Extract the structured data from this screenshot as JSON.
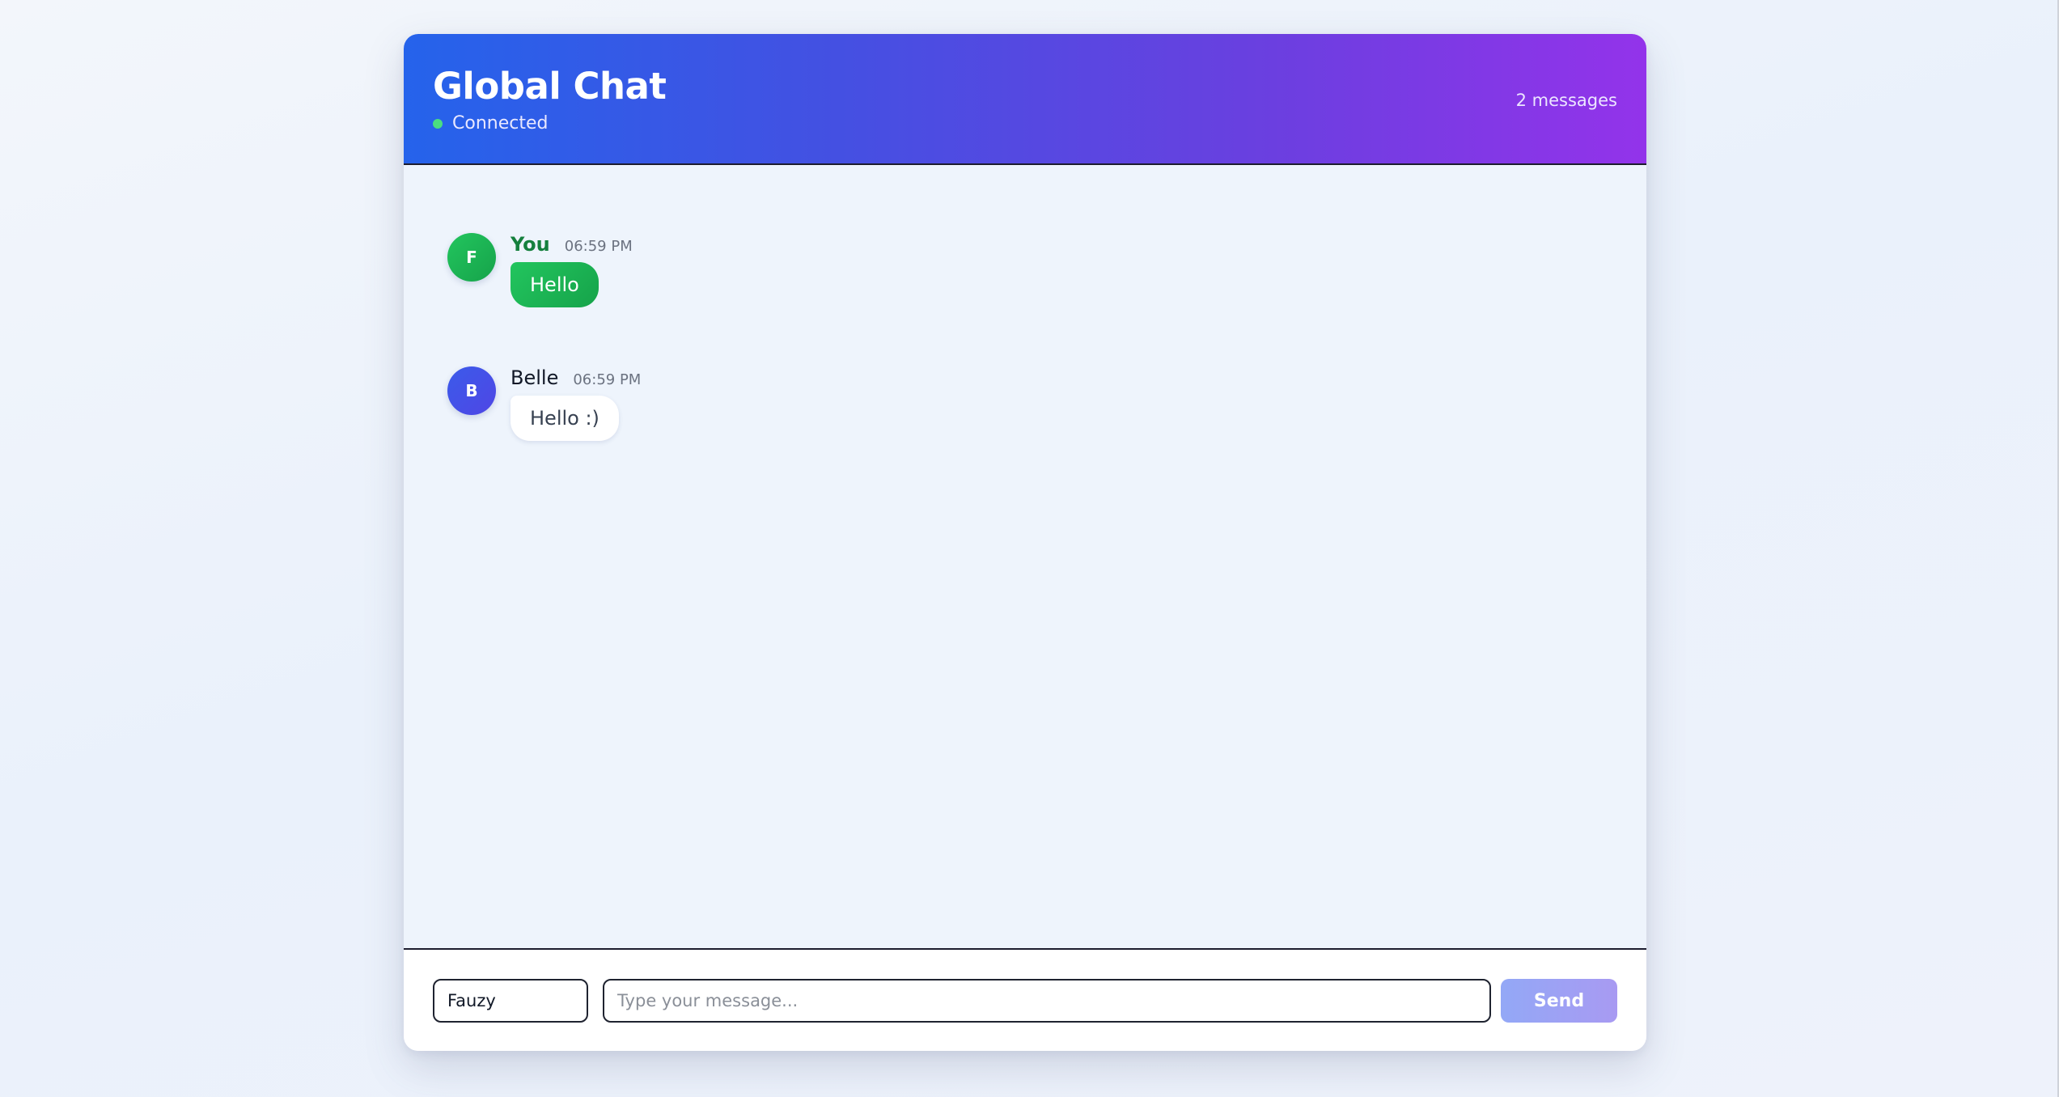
{
  "header": {
    "title": "Global Chat",
    "status": "Connected",
    "message_count": "2 messages"
  },
  "messages": [
    {
      "avatar_initial": "F",
      "sender": "You",
      "time": "06:59 PM",
      "text": "Hello"
    },
    {
      "avatar_initial": "B",
      "sender": "Belle",
      "time": "06:59 PM",
      "text": "Hello :)"
    }
  ],
  "composer": {
    "name_value": "Fauzy",
    "message_placeholder": "Type your message...",
    "send_label": "Send"
  },
  "colors": {
    "header_gradient_start": "#2563eb",
    "header_gradient_end": "#9333ea",
    "self_accent": "#16a34a",
    "other_avatar": "#4f46e5",
    "status_online": "#4ade80",
    "send_disabled": "#9aa6f4"
  }
}
